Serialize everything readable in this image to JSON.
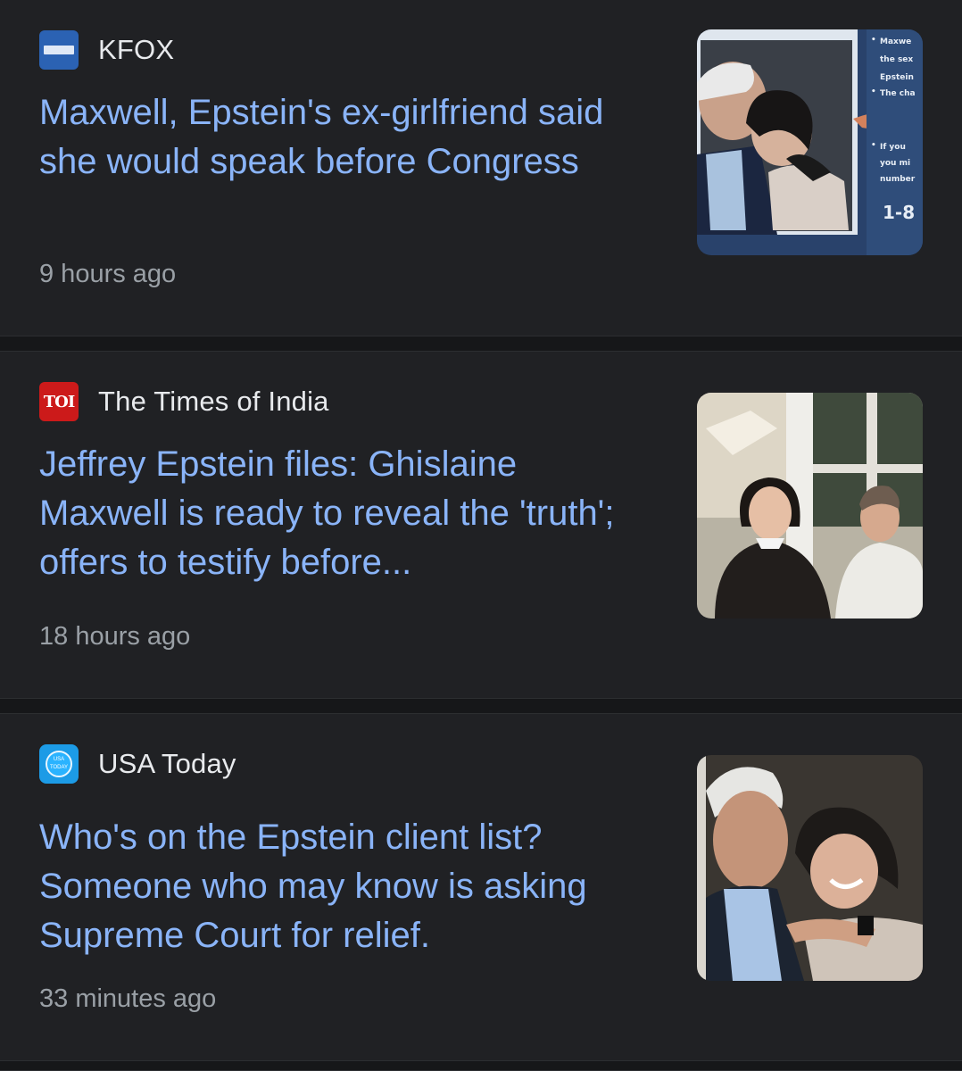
{
  "articles": [
    {
      "source": "KFOX",
      "headline": "Maxwell, Epstein's ex-girlfriend said she would speak before Congress",
      "time": "9 hours ago",
      "logo_color": "#2b62b3",
      "thumbnail_text": {
        "line1": "Maxwe",
        "line2": "the sex",
        "line3": "Epstein",
        "line4": "The cha",
        "line5": "If you",
        "line6": "you mi",
        "line7": "number",
        "line8": "1-8"
      }
    },
    {
      "source": "The Times of India",
      "logo_text": "TOI",
      "headline": "Jeffrey Epstein files: Ghislaine Maxwell is ready to reveal the 'truth'; offers to testify before...",
      "time": "18 hours ago",
      "logo_color": "#cc1a1a"
    },
    {
      "source": "USA Today",
      "logo_text": "USA TODAY",
      "headline": "Who's on the Epstein client list? Someone who may know is asking Supreme Court for relief.",
      "time": "33 minutes ago",
      "logo_color": "#1c9be6"
    }
  ],
  "colors": {
    "background": "#202124",
    "headline": "#8ab4f8",
    "source": "#e8eaed",
    "time": "#9aa0a6"
  }
}
